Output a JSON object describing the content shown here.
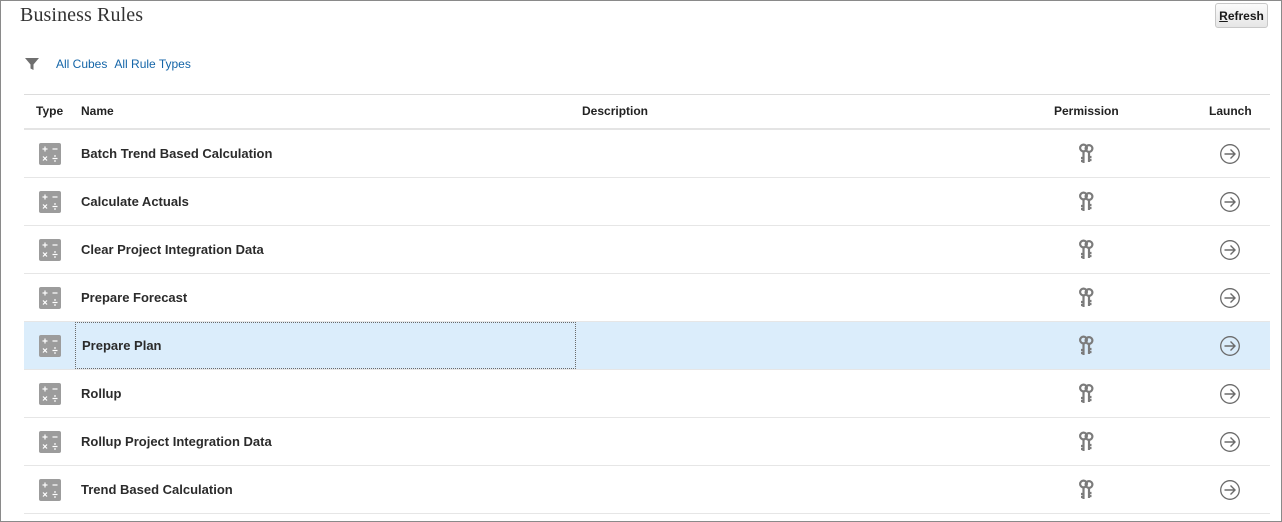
{
  "page": {
    "title": "Business Rules"
  },
  "toolbar": {
    "refresh_prefix": "R",
    "refresh_rest": "efresh"
  },
  "filters": {
    "cubes": "All Cubes",
    "rule_types": "All Rule Types"
  },
  "columns": {
    "type": "Type",
    "name": "Name",
    "description": "Description",
    "permission": "Permission",
    "launch": "Launch"
  },
  "rules": [
    {
      "name": "Batch Trend Based Calculation",
      "description": ""
    },
    {
      "name": "Calculate Actuals",
      "description": ""
    },
    {
      "name": "Clear Project Integration Data",
      "description": ""
    },
    {
      "name": "Prepare Forecast",
      "description": ""
    },
    {
      "name": "Prepare Plan",
      "description": ""
    },
    {
      "name": "Rollup",
      "description": ""
    },
    {
      "name": "Rollup Project Integration Data",
      "description": ""
    },
    {
      "name": "Trend Based Calculation",
      "description": ""
    }
  ],
  "selected_row_index": 4,
  "icons": {
    "type": "calculator-icon",
    "permission": "keys-icon",
    "launch": "arrow-circle-right-icon",
    "filter": "filter-icon"
  },
  "colors": {
    "link": "#1465a8",
    "selected_row": "#dbedfb",
    "icon_gray": "#9c9c9c"
  }
}
